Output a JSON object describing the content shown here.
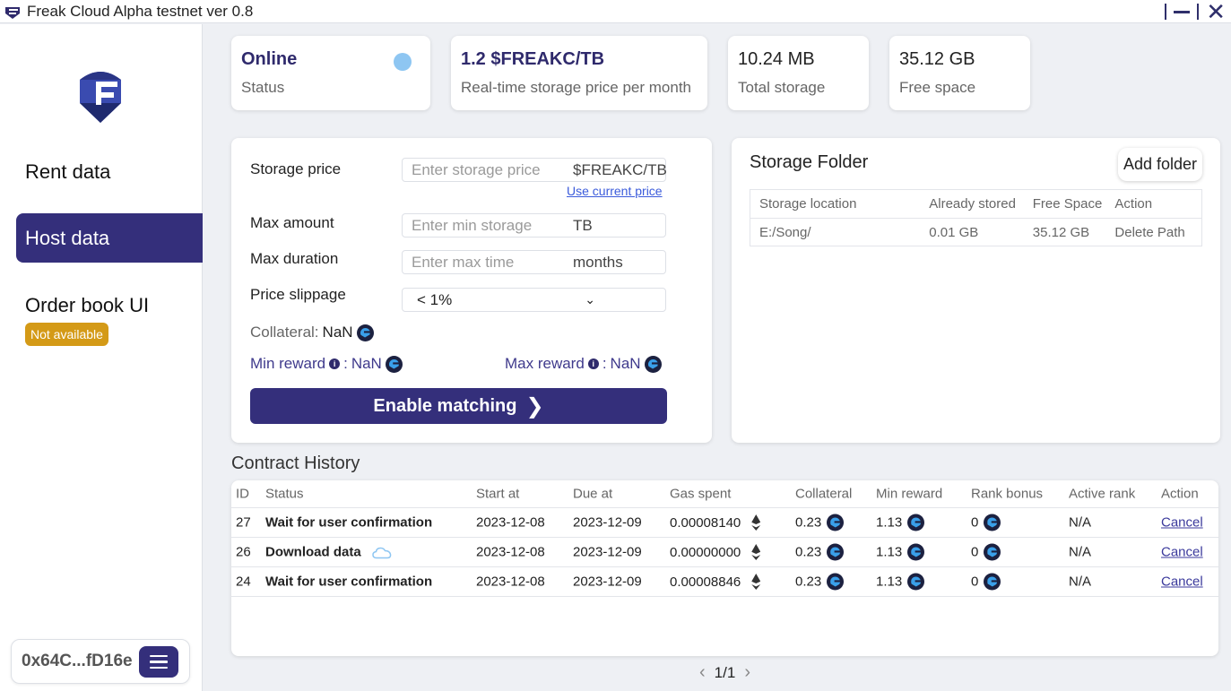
{
  "window": {
    "title": "Freak Cloud Alpha testnet ver 0.8"
  },
  "sidebar": {
    "items": [
      {
        "label": "Rent data"
      },
      {
        "label": "Host data"
      },
      {
        "label": "Order book UI",
        "badge": "Not available"
      }
    ],
    "wallet_address": "0x64C...fD16e"
  },
  "stats": [
    {
      "value": "Online",
      "label": "Status"
    },
    {
      "value": "1.2 $FREAKC/TB",
      "label": "Real-time storage price per month"
    },
    {
      "value": "10.24 MB",
      "label": "Total storage"
    },
    {
      "value": "35.12 GB",
      "label": "Free space"
    }
  ],
  "form": {
    "storage_price": {
      "label": "Storage price",
      "placeholder": "Enter storage price",
      "unit": "$FREAKC/TB",
      "link": "Use current price"
    },
    "max_amount": {
      "label": "Max amount",
      "placeholder": "Enter min storage",
      "unit": "TB"
    },
    "max_duration": {
      "label": "Max duration",
      "placeholder": "Enter max time",
      "unit": "months"
    },
    "price_slippage": {
      "label": "Price slippage",
      "value": "< 1%"
    },
    "collateral": {
      "label": "Collateral:",
      "value": "NaN"
    },
    "min_reward": {
      "label": "Min reward",
      "value": "NaN"
    },
    "max_reward": {
      "label": "Max reward",
      "value": "NaN"
    },
    "enable_button": "Enable matching"
  },
  "storage_folder": {
    "title": "Storage Folder",
    "add_button": "Add folder",
    "columns": [
      "Storage location",
      "Already stored",
      "Free Space",
      "Action"
    ],
    "rows": [
      [
        "E:/Song/",
        "0.01 GB",
        "35.12 GB",
        "Delete Path"
      ]
    ]
  },
  "contract_history": {
    "title": "Contract History",
    "columns": [
      "ID",
      "Status",
      "Start at",
      "Due at",
      "Gas spent",
      "Collateral",
      "Min reward",
      "Rank bonus",
      "Active rank",
      "Action"
    ],
    "rows": [
      {
        "id": "27",
        "status": "Wait for user confirmation",
        "start": "2023-12-08",
        "due": "2023-12-09",
        "gas": "0.00008140",
        "collateral": "0.23",
        "min_reward": "1.13",
        "rank_bonus": "0",
        "active_rank": "N/A",
        "action": "Cancel"
      },
      {
        "id": "26",
        "status": "Download data",
        "start": "2023-12-08",
        "due": "2023-12-09",
        "gas": "0.00000000",
        "collateral": "0.23",
        "min_reward": "1.13",
        "rank_bonus": "0",
        "active_rank": "N/A",
        "action": "Cancel"
      },
      {
        "id": "24",
        "status": "Wait for user confirmation",
        "start": "2023-12-08",
        "due": "2023-12-09",
        "gas": "0.00008846",
        "collateral": "0.23",
        "min_reward": "1.13",
        "rank_bonus": "0",
        "active_rank": "N/A",
        "action": "Cancel"
      }
    ],
    "pagination": "1/1"
  },
  "colors": {
    "primary": "#342f7b",
    "status_online": "#8ec6f2",
    "badge": "#d49a17",
    "link": "#3b5bdb"
  }
}
